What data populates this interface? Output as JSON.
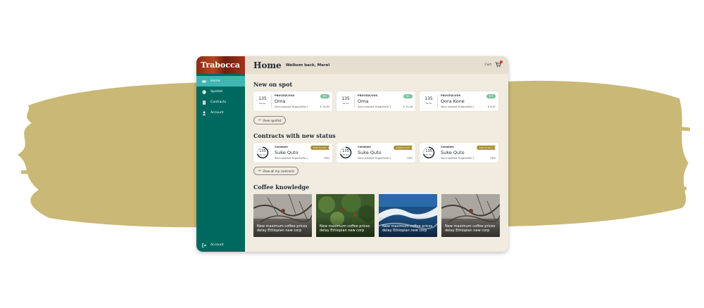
{
  "brand": {
    "name": "Trabocca",
    "bg_color": "#c9b876",
    "primary": "#00695f",
    "accent": "#3fb6b2"
  },
  "sidebar": {
    "items": [
      {
        "label": "Home",
        "icon": "cup-icon",
        "active": true
      },
      {
        "label": "Spotlist",
        "icon": "coffee-bean-icon",
        "active": false
      },
      {
        "label": "Contracts",
        "icon": "document-icon",
        "active": false
      },
      {
        "label": "Account",
        "icon": "user-icon",
        "active": false
      }
    ],
    "bottom": {
      "label": "Account",
      "icon": "logout-icon"
    }
  },
  "header": {
    "title": "Home",
    "welcome": "Welkom back, Merel",
    "cart_label": "Cart"
  },
  "spot": {
    "title": "New on spot",
    "cards": [
      {
        "qty": "135",
        "unit": "69 KG",
        "label": "PROCESS/VOS",
        "name": "Oma",
        "desc": "Semi washed  Yirgacheffe-1",
        "price": "€ 20,85",
        "badge": "78+"
      },
      {
        "qty": "135",
        "unit": "69 KG",
        "label": "PROCESS/VOS",
        "name": "Oma",
        "desc": "Semi washed  Yirgacheffe-1",
        "price": "€ 12,48",
        "badge": "78+"
      },
      {
        "qty": "135",
        "unit": "69 KG",
        "label": "PROCESS/VOS",
        "name": "Gora Kone",
        "desc": "Semi washed  Yirgacheffe-1",
        "price": "€ 6,67",
        "badge": "78+"
      }
    ],
    "button": "View spotlist"
  },
  "contracts": {
    "title": "Contracts with new status",
    "cards": [
      {
        "qty": "135",
        "unit": "69 KG",
        "label": "Colombia",
        "name": "Suke Quto",
        "desc": "Semi washed  Yirgacheffe-1",
        "code": "ORQ",
        "ribbon": "Expires soon",
        "progress": 0.7
      },
      {
        "qty": "135",
        "unit": "69 KG",
        "label": "Colombia",
        "name": "Suke Quto",
        "desc": "Semi washed  Yirgacheffe-1",
        "code": "ORQ",
        "ribbon": "Expires soon",
        "progress": 0.7
      },
      {
        "qty": "135",
        "unit": "69 KG",
        "label": "Colombia",
        "name": "Suke Quto",
        "desc": "Semi washed  Yirgacheffe-1",
        "code": "ORQ",
        "ribbon": "Expires soon",
        "progress": 0.7
      }
    ],
    "button": "View all my contracts"
  },
  "knowledge": {
    "title": "Coffee knowledge",
    "articles": [
      {
        "text": "New maximum coffee prices delay Ethiopian new corp"
      },
      {
        "text": "New maximum coffee prices delay Ethiopian new corp"
      },
      {
        "text": "New maximum coffee prices delay Ethiopian new corp"
      },
      {
        "text": "New maximum coffee prices delay Ethiopian new corp"
      }
    ]
  }
}
